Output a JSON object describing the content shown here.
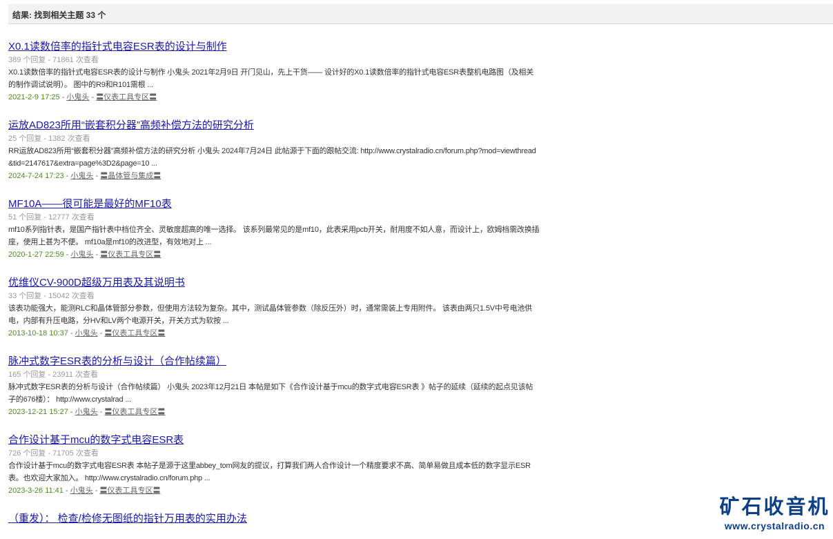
{
  "header": {
    "result_text": "结果: 找到相关主题 33 个"
  },
  "results": [
    {
      "title": "X0.1读数倍率的指针式电容ESR表的设计与制作",
      "meta": "389 个回复 - 71861 次查看",
      "desc": "X0.1读数倍率的指针式电容ESR表的设计与制作 小鬼头 2021年2月9日 开门见山，先上干货—— 设计好的X0.1读数倍率的指针式电容ESR表整机电路图（及相关的制作调试说明）。 图中的R9和R101需根 ...",
      "date": "2021-2-9 17:25",
      "author": "小鬼头",
      "forum": "〓仪表工具专区〓"
    },
    {
      "title": "运放AD823所用“嵌套积分器”高频补偿方法的研究分析",
      "meta": "25 个回复 - 1382 次查看",
      "desc": "RR运放AD823所用“嵌套积分器”高频补偿方法的研究分析 小鬼头 2024年7月24日 此帖源于下面的跟帖交流: http://www.crystalradio.cn/forum.php?mod=viewthread&tid=2147617&extra=page%3D2&page=10 ...",
      "date": "2024-7-24 17:23",
      "author": "小鬼头",
      "forum": "〓晶体管与集成〓"
    },
    {
      "title": "MF10A——很可能是最好的MF10表",
      "meta": "51 个回复 - 12777 次查看",
      "desc": "mf10系列指针表，是国产指针表中档位齐全、灵敏度超高的唯一选择。 该系列最常见的是mf10，此表采用pcb开关，耐用度不如人意，而设计上，欧姆档需改换插座，使用上甚为不便。 mf10a是mf10的改进型，有效地对上 ...",
      "date": "2020-1-27 22:59",
      "author": "小鬼头",
      "forum": "〓仪表工具专区〓"
    },
    {
      "title": "优维仪CV-900D超级万用表及其说明书",
      "meta": "33 个回复 - 15042 次查看",
      "desc": "该表功能强大，能测RLC和晶体管部分参数，但使用方法较为复杂。其中，测试晶体管参数（除反压外）时，通常需装上专用附件。 该表由两只1.5V中号电池供电，内部有升压电路，分HV和LV两个电源开关，开关方式为软按 ...",
      "date": "2013-10-18 10:37",
      "author": "小鬼头",
      "forum": "〓仪表工具专区〓"
    },
    {
      "title": "脉冲式数字ESR表的分析与设计（合作帖续篇）",
      "meta": "165 个回复 - 23911 次查看",
      "desc": "脉冲式数字ESR表的分析与设计（合作帖续篇） 小鬼头 2023年12月21日 本帖是如下《合作设计基于mcu的数字式电容ESR表 》帖子的延续（延续的起点见该帖子的676楼）： http://www.crystalrad ...",
      "date": "2023-12-21 15:27",
      "author": "小鬼头",
      "forum": "〓仪表工具专区〓"
    },
    {
      "title": "合作设计基于mcu的数字式电容ESR表",
      "meta": "726 个回复 - 71705 次查看",
      "desc": "合作设计基于mcu的数字式电容ESR表 本帖子是源于这里abbey_tom网友的提议，打算我们两人合作设计一个精度要求不高、简单易做且成本低的数字显示ESR表。也欢迎大家加入。 http://www.crystalradio.cn/forum.php ...",
      "date": "2023-3-26 11:41",
      "author": "小鬼头",
      "forum": "〓仪表工具专区〓"
    },
    {
      "title": "（重发）： 检查/检修无图纸的指针万用表的实用办法"
    }
  ],
  "logo": {
    "name": "矿石收音机",
    "url": "www.crystalradio.cn"
  },
  "colors": {
    "title_link": "#1a1aa6",
    "date": "#4d8a1f",
    "meta": "#999999",
    "logo": "#0d3f86"
  }
}
